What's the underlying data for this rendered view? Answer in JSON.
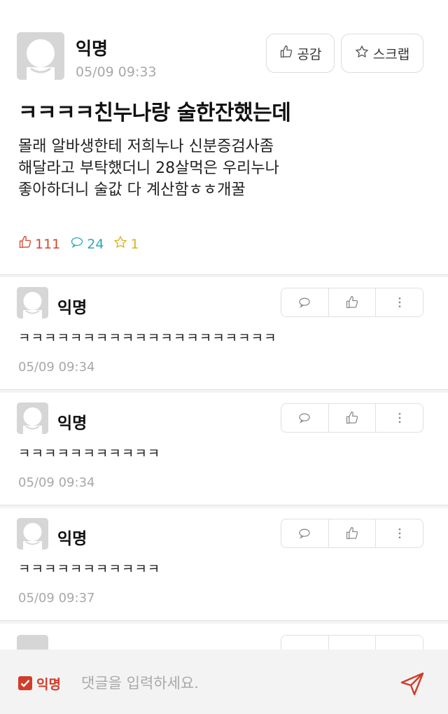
{
  "post": {
    "author": "익명",
    "time": "05/09 09:33",
    "like_button_label": "공감",
    "scrap_button_label": "스크랩",
    "title": "ㅋㅋㅋㅋ친누나랑 술한잔했는데",
    "body_lines": [
      "몰래 알바생한테 저희누나 신분증검사좀",
      "해달라고 부탁했더니 28살먹은 우리누나",
      "좋아하더니 술값 다 계산함ㅎㅎ개꿀"
    ],
    "stats": {
      "likes": "111",
      "comments": "24",
      "scraps": "1"
    }
  },
  "comments": [
    {
      "author": "익명",
      "text": "ㅋㅋㅋㅋㅋㅋㅋㅋㅋㅋㅋㅋㅋㅋㅋㅋㅋㅋㅋㅋ",
      "time": "05/09 09:34"
    },
    {
      "author": "익명",
      "text": "ㅋㅋㅋㅋㅋㅋㅋㅋㅋㅋㅋ",
      "time": "05/09 09:34"
    },
    {
      "author": "익명",
      "text": "ㅋㅋㅋㅋㅋㅋㅋㅋㅋㅋㅋ",
      "time": "05/09 09:37"
    }
  ],
  "input": {
    "anonymous_label": "익명",
    "anonymous_checked": true,
    "placeholder": "댓글을 입력하세요."
  },
  "colors": {
    "like": "#d8452c",
    "comment": "#2fa5b6",
    "scrap": "#e0b01e",
    "accent": "#d23c2a"
  },
  "icons": [
    "thumbs-up-icon",
    "star-icon",
    "speech-bubble-icon",
    "more-vertical-icon",
    "checkbox-icon",
    "send-icon",
    "avatar-icon"
  ]
}
